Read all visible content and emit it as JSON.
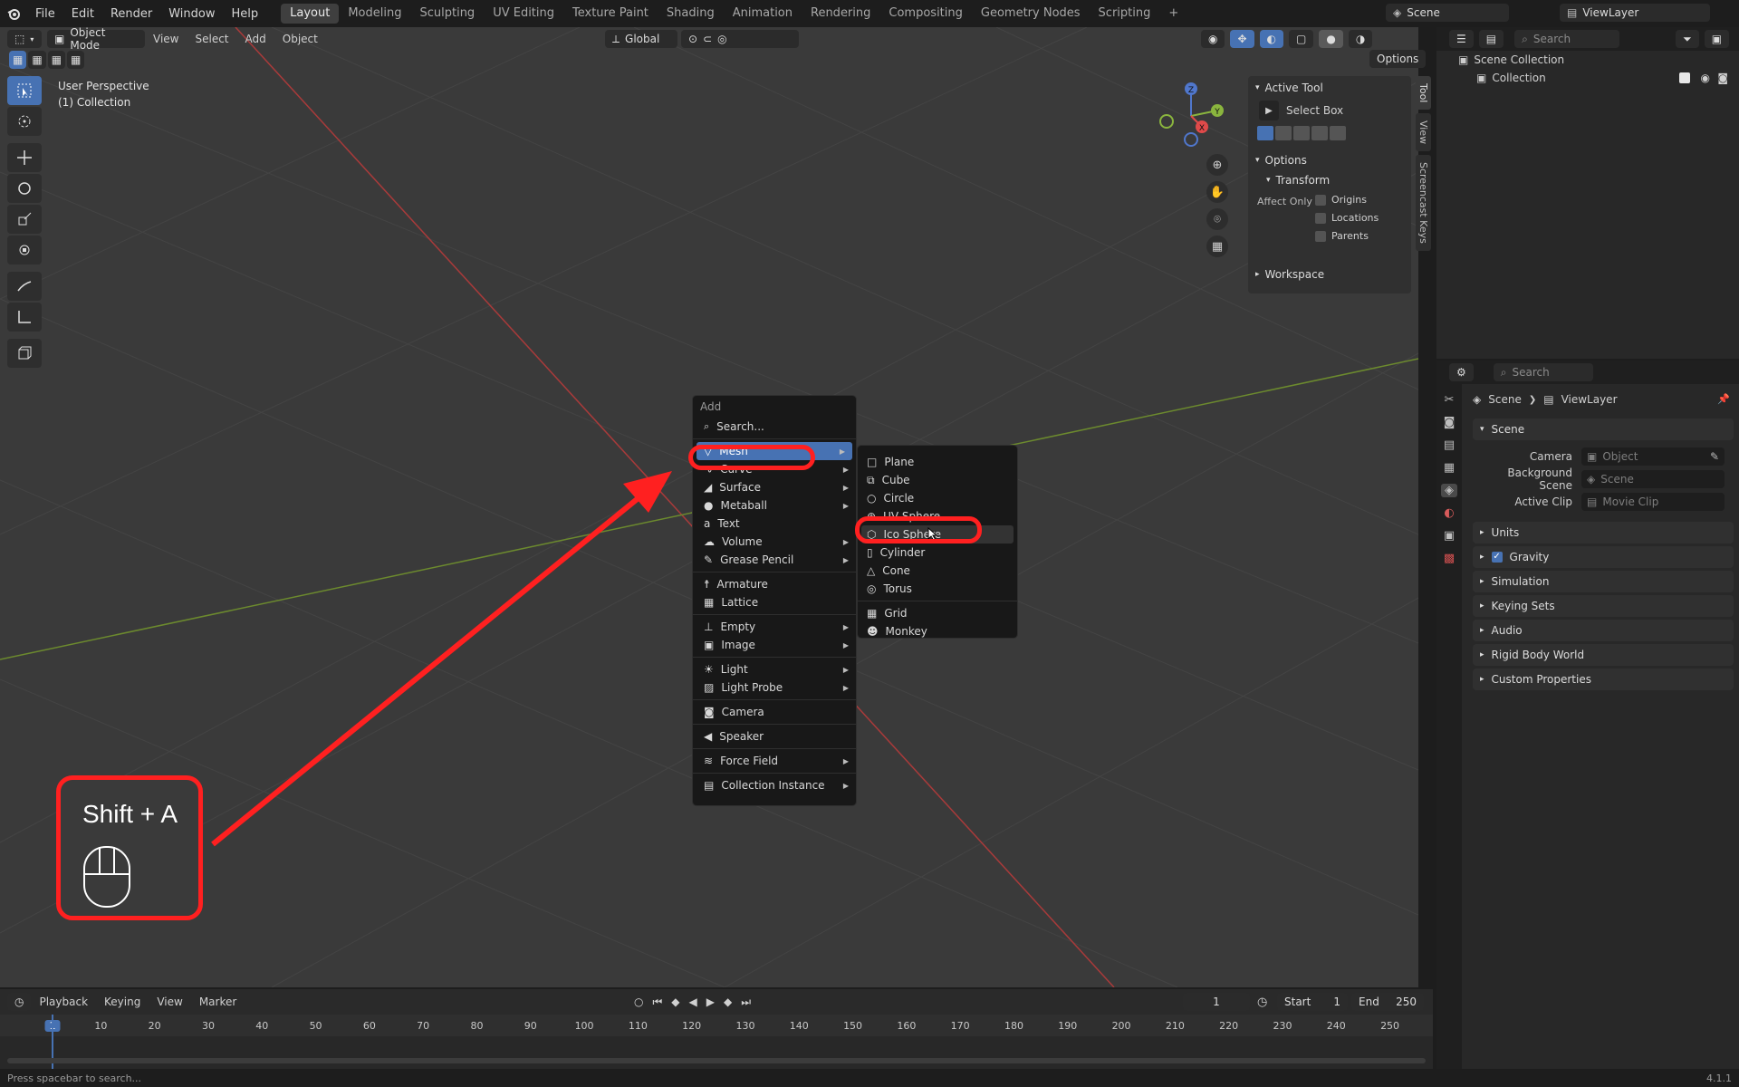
{
  "topbar": {
    "menus": [
      "File",
      "Edit",
      "Render",
      "Window",
      "Help"
    ],
    "workspaces": [
      "Layout",
      "Modeling",
      "Sculpting",
      "UV Editing",
      "Texture Paint",
      "Shading",
      "Animation",
      "Rendering",
      "Compositing",
      "Geometry Nodes",
      "Scripting"
    ],
    "active_workspace": "Layout",
    "add_workspace": "+",
    "scene": "Scene",
    "view_layer": "ViewLayer"
  },
  "viewport_header": {
    "mode": "Object Mode",
    "menus": [
      "View",
      "Select",
      "Add",
      "Object"
    ],
    "transform_orientation": "Global",
    "options_label": "Options"
  },
  "viewport": {
    "perspective_label": "User Perspective",
    "collection_label": "(1) Collection",
    "gizmo_axes": [
      "Z",
      "Y",
      "X"
    ]
  },
  "npanel": {
    "active_tool_title": "Active Tool",
    "tool_name": "Select Box",
    "options_title": "Options",
    "transform_title": "Transform",
    "affect_only_label": "Affect Only",
    "checkboxes": [
      "Origins",
      "Locations",
      "Parents"
    ],
    "workspace_title": "Workspace",
    "tabs": [
      "Tool",
      "View",
      "Screencast Keys"
    ]
  },
  "add_menu": {
    "title": "Add",
    "search": "Search...",
    "items": [
      {
        "label": "Mesh",
        "icon": "mesh-icon",
        "submenu": true
      },
      {
        "label": "Curve",
        "icon": "curve-icon",
        "submenu": true
      },
      {
        "label": "Surface",
        "icon": "surface-icon",
        "submenu": true
      },
      {
        "label": "Metaball",
        "icon": "metaball-icon",
        "submenu": true
      },
      {
        "label": "Text",
        "icon": "text-icon",
        "submenu": false
      },
      {
        "label": "Volume",
        "icon": "volume-icon",
        "submenu": true
      },
      {
        "label": "Grease Pencil",
        "icon": "grease-pencil-icon",
        "submenu": true
      },
      {
        "label": "Armature",
        "icon": "armature-icon",
        "submenu": false
      },
      {
        "label": "Lattice",
        "icon": "lattice-icon",
        "submenu": false
      },
      {
        "label": "Empty",
        "icon": "empty-icon",
        "submenu": true
      },
      {
        "label": "Image",
        "icon": "image-icon",
        "submenu": true
      },
      {
        "label": "Light",
        "icon": "light-icon",
        "submenu": true
      },
      {
        "label": "Light Probe",
        "icon": "light-probe-icon",
        "submenu": true
      },
      {
        "label": "Camera",
        "icon": "camera-icon",
        "submenu": false
      },
      {
        "label": "Speaker",
        "icon": "speaker-icon",
        "submenu": false
      },
      {
        "label": "Force Field",
        "icon": "force-field-icon",
        "submenu": true
      },
      {
        "label": "Collection Instance",
        "icon": "collection-instance-icon",
        "submenu": true
      }
    ]
  },
  "mesh_submenu": {
    "items": [
      "Plane",
      "Cube",
      "Circle",
      "UV Sphere",
      "Ico Sphere",
      "Cylinder",
      "Cone",
      "Torus",
      "Grid",
      "Monkey"
    ],
    "hovered": "Ico Sphere"
  },
  "annotation": {
    "shortcut": "Shift + A"
  },
  "outliner": {
    "search_placeholder": "Search",
    "items": [
      "Scene Collection",
      "Collection"
    ]
  },
  "properties": {
    "search_placeholder": "Search",
    "breadcrumb": [
      "Scene",
      "ViewLayer"
    ],
    "scene_section": "Scene",
    "fields": [
      {
        "label": "Camera",
        "placeholder": "Object"
      },
      {
        "label": "Background Scene",
        "placeholder": "Scene"
      },
      {
        "label": "Active Clip",
        "placeholder": "Movie Clip"
      }
    ],
    "sections": [
      "Units",
      "Gravity",
      "Simulation",
      "Keying Sets",
      "Audio",
      "Rigid Body World",
      "Custom Properties"
    ]
  },
  "timeline": {
    "menus": [
      "Playback",
      "Keying",
      "View",
      "Marker"
    ],
    "current_frame": "1",
    "start_label": "Start",
    "start": "1",
    "end_label": "End",
    "end": "250",
    "ticks": [
      "1",
      "10",
      "20",
      "30",
      "40",
      "50",
      "60",
      "70",
      "80",
      "90",
      "100",
      "110",
      "120",
      "130",
      "140",
      "150",
      "160",
      "170",
      "180",
      "190",
      "200",
      "210",
      "220",
      "230",
      "240",
      "250"
    ]
  },
  "statusbar": {
    "hint": "Press spacebar to search...",
    "version": "4.1.1"
  },
  "colors": {
    "accent": "#4772b3",
    "highlight": "#ff2020",
    "x_axis": "#a93a3a",
    "y_axis": "#6c8a2e"
  }
}
